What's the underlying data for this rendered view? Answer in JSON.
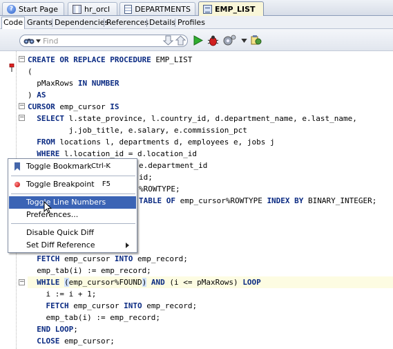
{
  "tabs": [
    {
      "label": "Start Page",
      "icon": "help-icon"
    },
    {
      "label": "hr_orcl",
      "icon": "database-icon"
    },
    {
      "label": "DEPARTMENTS",
      "icon": "table-icon"
    },
    {
      "label": "EMP_LIST",
      "icon": "procedure-icon",
      "active": true
    }
  ],
  "subtabs": [
    "Code",
    "Grants",
    "Dependencies",
    "References",
    "Details",
    "Profiles"
  ],
  "search": {
    "placeholder": "Find"
  },
  "code_lines": [
    "CREATE OR REPLACE PROCEDURE EMP_LIST",
    "(",
    "  pMaxRows IN NUMBER",
    ") AS",
    "CURSOR emp_cursor IS",
    "  SELECT l.state_province, l.country_id, d.department_name, e.last_name,",
    "         j.job_title, e.salary, e.commission_pct",
    "  FROM locations l, departments d, employees e, jobs j",
    "  WHERE l.location_id = d.location_id",
    "e.department_id",
    "id;",
    "%ROWTYPE;",
    "TABLE OF emp_cursor%ROWTYPE INDEX BY BINARY_INTEGER;",
    "  FETCH emp_cursor INTO emp_record;",
    "  emp_tab(i) := emp_record;",
    "  WHILE (emp_cursor%FOUND) AND (i <= pMaxRows) LOOP",
    "    i := i + 1;",
    "    FETCH emp_cursor INTO emp_record;",
    "    emp_tab(i) := emp_record;",
    "  END LOOP;",
    "  CLOSE emp_cursor;"
  ],
  "context_menu": {
    "items": [
      {
        "label": "Toggle Bookmark",
        "shortcut": "Ctrl-K"
      },
      {
        "label": "Toggle Breakpoint",
        "shortcut": "F5"
      },
      {
        "label": "Toggle Line Numbers"
      },
      {
        "label": "Preferences..."
      },
      {
        "label": "Disable Quick Diff"
      },
      {
        "label": "Set Diff Reference"
      }
    ]
  }
}
